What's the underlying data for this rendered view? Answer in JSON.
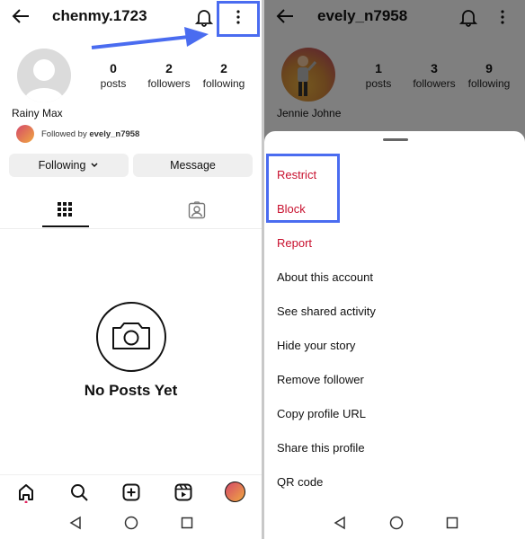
{
  "left": {
    "username": "chenmy.1723",
    "display_name": "Rainy Max",
    "stats": [
      {
        "value": "0",
        "label": "posts"
      },
      {
        "value": "2",
        "label": "followers"
      },
      {
        "value": "2",
        "label": "following"
      }
    ],
    "followed_by_prefix": "Followed by ",
    "followed_by_user": "evely_n7958",
    "buttons": {
      "following": "Following",
      "message": "Message"
    },
    "empty_title": "No Posts Yet"
  },
  "right": {
    "username": "evely_n7958",
    "display_name": "Jennie Johne",
    "stats": [
      {
        "value": "1",
        "label": "posts"
      },
      {
        "value": "3",
        "label": "followers"
      },
      {
        "value": "9",
        "label": "following"
      }
    ],
    "menu": [
      {
        "label": "Restrict",
        "danger": true
      },
      {
        "label": "Block",
        "danger": true
      },
      {
        "label": "Report",
        "danger": true
      },
      {
        "label": "About this account"
      },
      {
        "label": "See shared activity"
      },
      {
        "label": "Hide your story"
      },
      {
        "label": "Remove follower"
      },
      {
        "label": "Copy profile URL"
      },
      {
        "label": "Share this profile"
      },
      {
        "label": "QR code"
      }
    ]
  },
  "colors": {
    "highlight": "#4a6cf0",
    "danger": "#c8102e",
    "notification_dot": "#e0245e"
  }
}
